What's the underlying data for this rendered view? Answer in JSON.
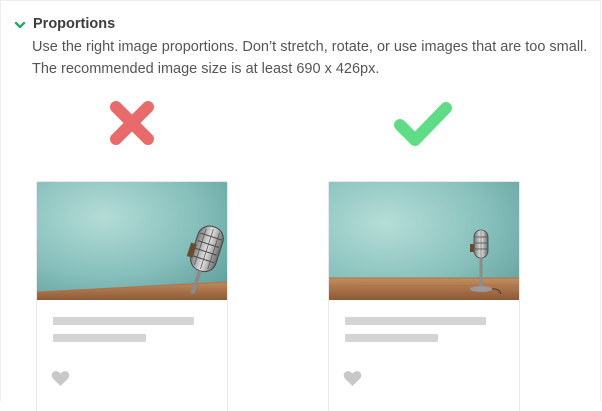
{
  "section": {
    "title": "Proportions",
    "description": "Use the right image proportions. Don’t stretch, rotate, or use images that are too small. The recommended image size is at least 690 x 426px."
  },
  "examples": [
    {
      "verdict": "incorrect",
      "icon": "cross-icon",
      "color": "#e86a6a",
      "image": "stretched-microphone-photo"
    },
    {
      "verdict": "correct",
      "icon": "check-icon",
      "color": "#5fdc85",
      "image": "microphone-photo"
    }
  ],
  "colors": {
    "accent": "#2aa865",
    "placeholder": "#d4d4d4",
    "heart": "#c8c8c8"
  }
}
